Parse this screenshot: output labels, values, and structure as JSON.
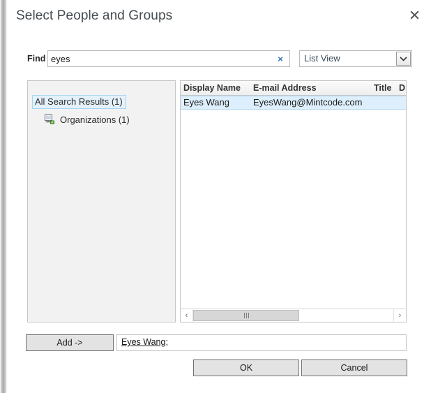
{
  "dialog": {
    "title": "Select People and Groups",
    "close_icon": "close-icon"
  },
  "search": {
    "label": "Find",
    "value": "eyes",
    "placeholder": "",
    "clear_icon": "×",
    "view_selected": "List View",
    "view_options": [
      "List View"
    ],
    "dropdown_icon": "chevron-down-icon"
  },
  "tree": {
    "items": [
      {
        "label": "All Search Results (1)",
        "selected": true,
        "icon": ""
      },
      {
        "label": "Organizations (1)",
        "selected": false,
        "icon": "organizations-icon"
      }
    ]
  },
  "results": {
    "columns": [
      "Display Name",
      "E-mail Address",
      "Title",
      "D"
    ],
    "rows": [
      {
        "display_name": "Eyes Wang",
        "email": "EyesWang@Mintcode.com",
        "title": "",
        "selected": true
      }
    ],
    "scrollbar": {
      "left_arrow": "‹",
      "right_arrow": "›",
      "grip": "|||"
    }
  },
  "selection": {
    "add_label": "Add ->",
    "resolved_name": "Eyes Wang",
    "separator": ";"
  },
  "footer": {
    "ok_label": "OK",
    "cancel_label": "Cancel"
  },
  "colors": {
    "accent_blue": "#2e74b5",
    "row_selected": "#ddeffc",
    "panel_bg": "#f2f2f2",
    "button_face": "#e3e3e3"
  }
}
